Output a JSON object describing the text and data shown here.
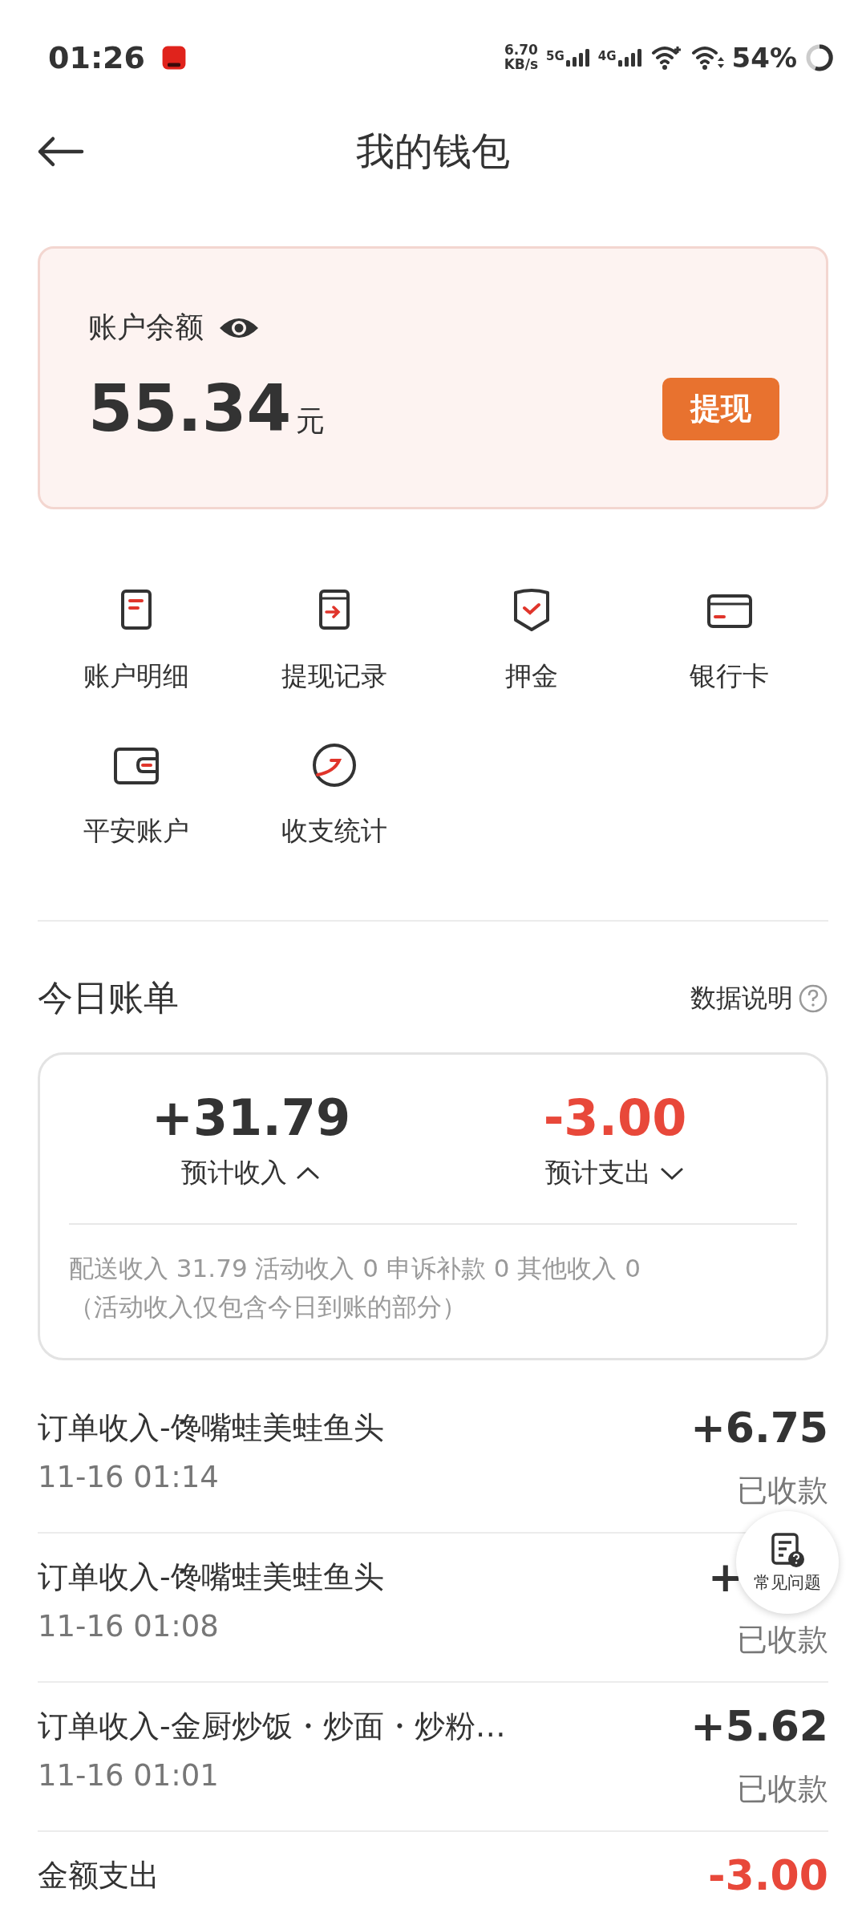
{
  "status_bar": {
    "time": "01:26",
    "net_speed": "6.70",
    "net_unit": "KB/s",
    "sim_1": "5G",
    "sim_2": "4G",
    "battery": "54%"
  },
  "header": {
    "title": "我的钱包"
  },
  "balance": {
    "label": "账户余额",
    "amount": "55.34",
    "unit": "元",
    "button": "提现"
  },
  "shortcuts": [
    {
      "label": "账户明细",
      "kind": "doc"
    },
    {
      "label": "提现记录",
      "kind": "transfer"
    },
    {
      "label": "押金",
      "kind": "shield"
    },
    {
      "label": "银行卡",
      "kind": "card"
    },
    {
      "label": "平安账户",
      "kind": "wallet"
    },
    {
      "label": "收支统计",
      "kind": "stats"
    }
  ],
  "today": {
    "title": "今日账单",
    "help": "数据说明",
    "income": {
      "amount": "+31.79",
      "label": "预计收入",
      "expanded": true
    },
    "expense": {
      "amount": "-3.00",
      "label": "预计支出",
      "expanded": false
    },
    "breakdown": [
      "配送收入 31.79 活动收入 0 申诉补款 0 其他收入 0",
      "（活动收入仅包含今日到账的部分）"
    ]
  },
  "transactions": [
    {
      "title": "订单收入-馋嘴蛙美蛙鱼头",
      "time": "11-16 01:14",
      "amount": "+6.75",
      "status": "已收款",
      "kind": "income"
    },
    {
      "title": "订单收入-馋嘴蛙美蛙鱼头",
      "time": "11-16 01:08",
      "amount": "+",
      "status": "已收款",
      "kind": "income"
    },
    {
      "title": "订单收入-金厨炒饭・炒面・炒粉…",
      "time": "11-16 01:01",
      "amount": "+5.62",
      "status": "已收款",
      "kind": "income"
    },
    {
      "title": "金额支出",
      "amount": "-3.00",
      "kind": "expense"
    }
  ],
  "fab": {
    "label": "常见问题"
  }
}
